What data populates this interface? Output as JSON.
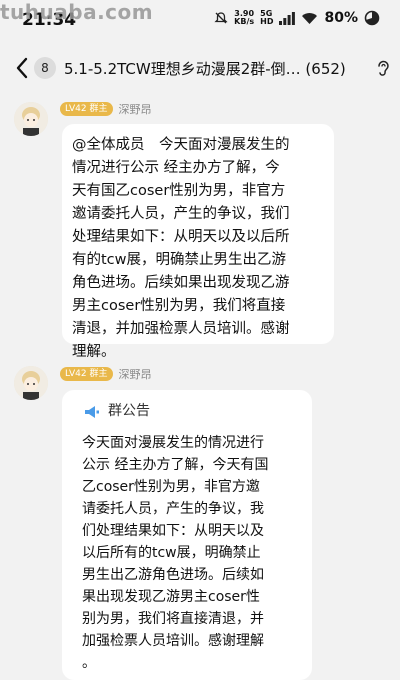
{
  "watermark": "tuhuaba.com",
  "status_bar": {
    "time": "21:34",
    "net_speed_value": "3.90",
    "net_speed_unit": "KB/s",
    "network_top": "5G",
    "network_bottom": "HD",
    "battery": "80%"
  },
  "nav": {
    "unread_count": "8",
    "title": "5.1-5.2TCW理想乡动漫展2群-倒… (652)"
  },
  "messages": [
    {
      "level": "LV42 群主",
      "sender": "深野昂",
      "text": "@全体成员　今天面对漫展发生的\n情况进行公示 经主办方了解，今\n天有国乙coser性别为男，非官方\n邀请委托人员，产生的争议，我们\n处理结果如下：从明天以及以后所\n有的tcw展，明确禁止男生出乙游\n角色进场。后续如果出现发现乙游\n男主coser性别为男，我们将直接\n清退，并加强检票人员培训。感谢\n理解。"
    },
    {
      "level": "LV42 群主",
      "sender": "深野昂",
      "notice_title": "群公告",
      "text": "今天面对漫展发生的情况进行\n公示 经主办方了解，今天有国\n乙coser性别为男，非官方邀\n请委托人员，产生的争议，我\n们处理结果如下：从明天以及\n以后所有的tcw展，明确禁止\n男生出乙游角色进场。后续如\n果出现发现乙游男主coser性\n别为男，我们将直接清退，并\n加强检票人员培训。感谢理解\n。"
    }
  ]
}
